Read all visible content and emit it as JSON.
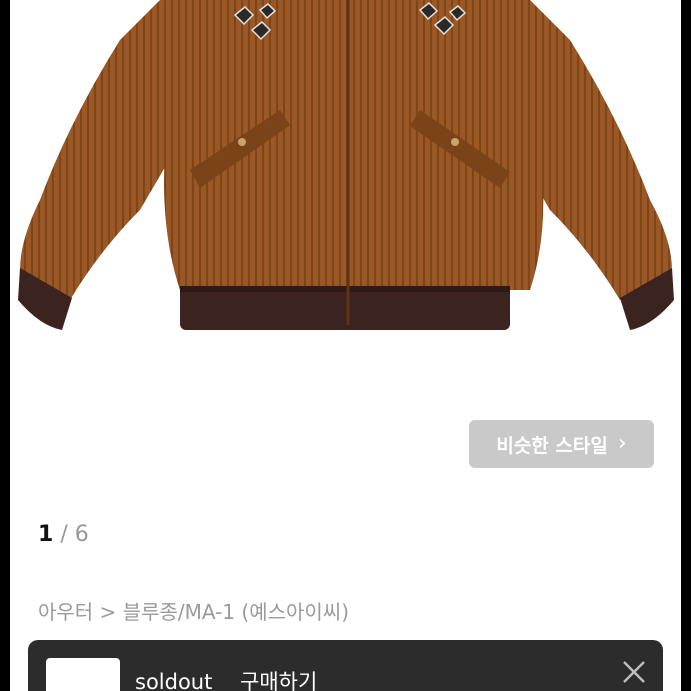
{
  "similar_style": {
    "label": "비슷한 스타일",
    "icon": "chevron-right-icon"
  },
  "pager": {
    "current": "1",
    "separator": "/",
    "total": "6"
  },
  "category": {
    "path": "아우터 > 블루종/MA-1 (예스아이씨)"
  },
  "bottom_bar": {
    "text": "soldout__ 구매하기",
    "close_icon": "close-icon"
  },
  "colors": {
    "jacket": "#9c5a27",
    "rib": "#3b2420",
    "button_bg": "#c9c9c9",
    "bar_bg": "#2c2c2c"
  }
}
